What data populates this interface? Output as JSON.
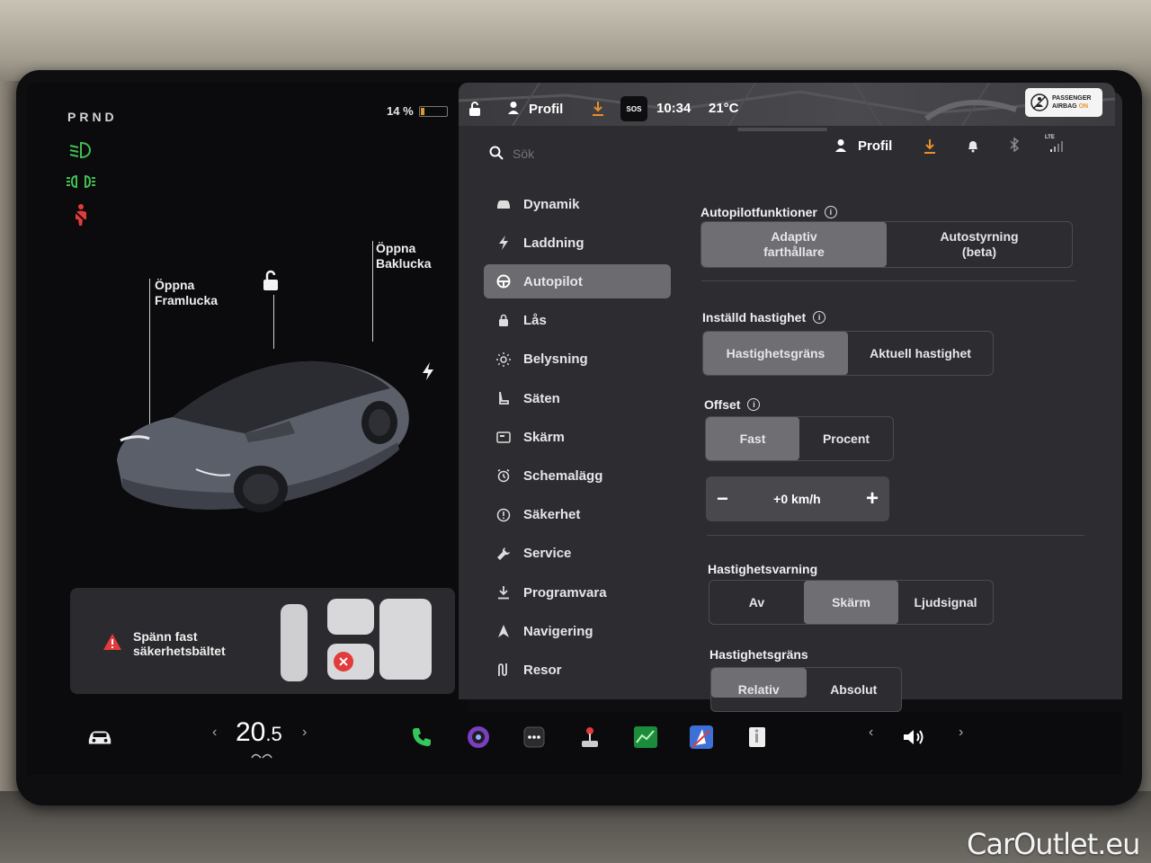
{
  "left_panel": {
    "gear": "PRND",
    "battery_percent": "14 %",
    "battery_level": 0.14,
    "front_trunk_label": "Öppna\nFramlucka",
    "rear_trunk_label": "Öppna\nBaklucka",
    "seatbelt_alert": "Spänn fast\nsäkerhetsbältet",
    "colors": {
      "green": "#3fbf53",
      "red": "#e23b3b",
      "accent": "#d79a32"
    }
  },
  "status_bar": {
    "profile": "Profil",
    "sos": "SOS",
    "time": "10:34",
    "temp": "21°C",
    "airbag_line1": "PASSENGER",
    "airbag_line2": "AIRBAG",
    "airbag_state": "ON"
  },
  "header": {
    "search_placeholder": "Sök",
    "profile": "Profil",
    "lte": "LTE"
  },
  "menu": [
    {
      "label": "Dynamik",
      "icon": "car-icon"
    },
    {
      "label": "Laddning",
      "icon": "bolt-icon"
    },
    {
      "label": "Autopilot",
      "icon": "steering-wheel-icon",
      "active": true
    },
    {
      "label": "Lås",
      "icon": "lock-icon"
    },
    {
      "label": "Belysning",
      "icon": "sun-icon"
    },
    {
      "label": "Säten",
      "icon": "seat-icon"
    },
    {
      "label": "Skärm",
      "icon": "display-icon"
    },
    {
      "label": "Schemalägg",
      "icon": "alarm-clock-icon"
    },
    {
      "label": "Säkerhet",
      "icon": "alert-circle-icon"
    },
    {
      "label": "Service",
      "icon": "wrench-icon"
    },
    {
      "label": "Programvara",
      "icon": "download-icon"
    },
    {
      "label": "Navigering",
      "icon": "navigation-icon"
    },
    {
      "label": "Resor",
      "icon": "trips-icon"
    }
  ],
  "settings": {
    "autopilot_features": {
      "title": "Autopilotfunktioner",
      "options": [
        "Adaptiv\nfarthållare",
        "Autostyrning\n(beta)"
      ],
      "selected": 0
    },
    "set_speed": {
      "title": "Inställd hastighet",
      "options": [
        "Hastighetsgräns",
        "Aktuell hastighet"
      ],
      "selected": 0
    },
    "offset": {
      "title": "Offset",
      "options": [
        "Fast",
        "Procent"
      ],
      "selected": 0,
      "value": "+0 km/h",
      "minus": "−",
      "plus": "+"
    },
    "speed_warning": {
      "title": "Hastighetsvarning",
      "options": [
        "Av",
        "Skärm",
        "Ljudsignal"
      ],
      "selected": 1
    },
    "speed_limit": {
      "title": "Hastighetsgräns",
      "options": [
        "Relativ",
        "Absolut"
      ],
      "selected": 0
    }
  },
  "dock": {
    "temperature_main": "20",
    "temperature_decimal": ".5",
    "left_arrow": "‹",
    "right_arrow": "›"
  },
  "watermark": "CarOutlet.eu"
}
